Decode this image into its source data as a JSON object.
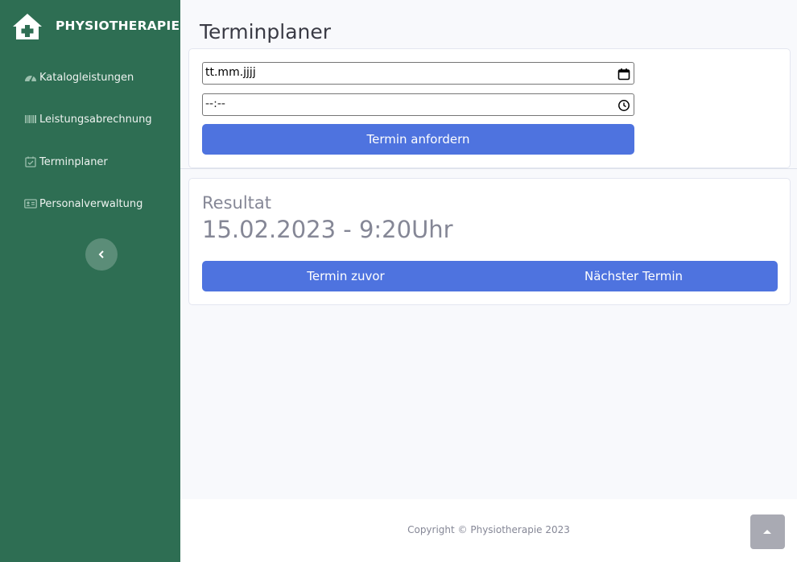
{
  "brand": {
    "name": "PHYSIOTHERAPIE",
    "icon": "clinic-house-icon"
  },
  "sidebar": {
    "items": [
      {
        "label": "Katalogleistungen",
        "icon": "tachometer-icon"
      },
      {
        "label": "Leistungsabrechnung",
        "icon": "barcode-icon"
      },
      {
        "label": "Terminplaner",
        "icon": "calendar-check-icon"
      },
      {
        "label": "Personalverwaltung",
        "icon": "id-card-icon"
      }
    ],
    "toggle_icon": "chevron-left-icon"
  },
  "page": {
    "title": "Terminplaner"
  },
  "form": {
    "date_value": "tt.mm.jjjj",
    "time_value": "--:--",
    "request_button": "Termin anfordern"
  },
  "result": {
    "label": "Resultat",
    "value": "15.02.2023 - 9:20Uhr",
    "prev_button": "Termin zuvor",
    "next_button": "Nächster Termin"
  },
  "footer": {
    "copyright": "Copyright © Physiotherapie 2023"
  },
  "colors": {
    "sidebar": "#2e6e53",
    "primary": "#4e73df",
    "background": "#f8f9fc"
  }
}
